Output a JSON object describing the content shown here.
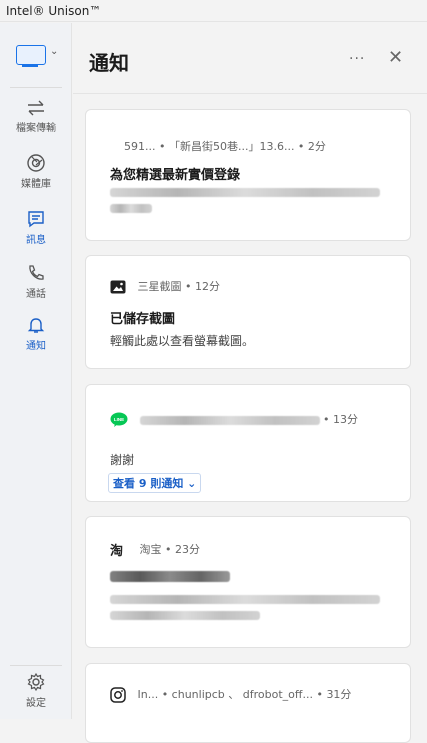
{
  "window": {
    "title": "Intel® Unison™"
  },
  "sidebar": {
    "items": [
      {
        "label": "檔案傳輸",
        "icon": "transfer-icon"
      },
      {
        "label": "媒體庫",
        "icon": "gallery-icon"
      },
      {
        "label": "訊息",
        "icon": "message-icon"
      },
      {
        "label": "通話",
        "icon": "phone-icon"
      },
      {
        "label": "通知",
        "icon": "bell-icon"
      }
    ],
    "settings_label": "設定"
  },
  "header": {
    "title": "通知",
    "more_label": "···",
    "close_label": "✕"
  },
  "notifications": [
    {
      "meta": "591... • 「新昌街50巷...」13.6... • 2分",
      "title": "為您精選最新實價登錄",
      "body_blurred": true
    },
    {
      "app": "三星截圖",
      "time": "12分",
      "app_icon": "screenshot-icon",
      "title": "已儲存截圖",
      "body": "輕觸此處以查看螢幕截圖。"
    },
    {
      "app_icon": "line-icon",
      "app_label": "LINE",
      "time": "13分",
      "body": "謝謝",
      "more_label": "查看 9 則通知",
      "more_chevron": "⌄"
    },
    {
      "app": "淘宝",
      "time": "23分",
      "app_icon": "taobao-icon",
      "body_blurred": true
    },
    {
      "app_icon": "instagram-icon",
      "meta": "In... • chunlipcb 、 dfrobot_off... • 31分"
    }
  ],
  "colors": {
    "accent": "#1a5fc7",
    "line_green": "#06c755"
  }
}
